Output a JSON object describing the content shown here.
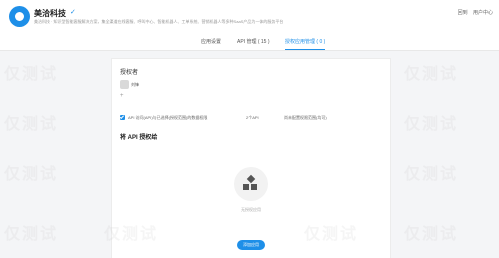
{
  "header": {
    "app_name": "美洽科技",
    "verified_icon": "verified-icon",
    "subtitle": "美洽科技 · 知识型智能客服解决方案，集全渠道在线客服、呼叫中心、智能机器人、工单系统、营销机器人等多种SaaS产品为一体的服务平台",
    "right_links": [
      "回到",
      "用户中心"
    ]
  },
  "tabs": [
    {
      "label": "应用设置",
      "active": false
    },
    {
      "label": "API 管理 ( 15 )",
      "active": false
    },
    {
      "label": "授权应用管理 ( 0 )",
      "active": true
    }
  ],
  "panel": {
    "owner_label": "授权者",
    "owner_name": "刘锋",
    "add_owner": "+",
    "permission_row": {
      "text_1": "API 访问(API)与已选择(授权范围)的数据权限",
      "text_2": "2个API",
      "text_3": "尚未配置权限范围(均可)"
    },
    "section_title": "将 API 授权给",
    "empty_text": "无授权应用",
    "add_button": "添加应用"
  },
  "watermark_text": "仅测试",
  "colors": {
    "accent": "#1e8fe8",
    "background": "#f4f5f7"
  }
}
